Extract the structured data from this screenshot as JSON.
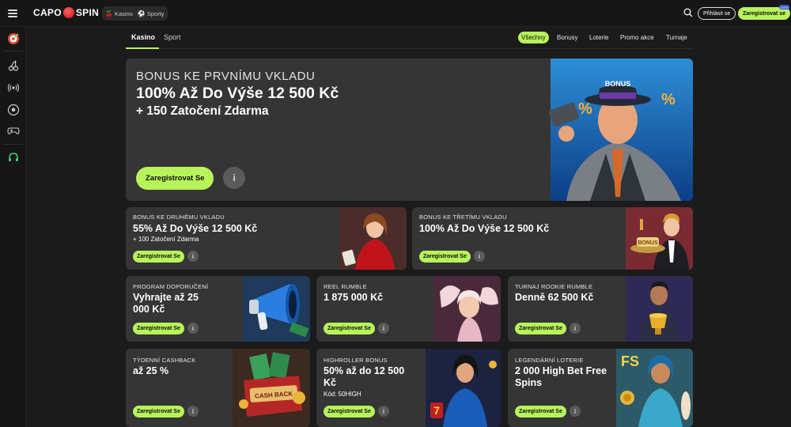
{
  "header": {
    "logo_left": "CAPO",
    "logo_right": "SPIN",
    "modes": [
      "Kasino",
      "Sporty"
    ],
    "login_label": "Přihlásit se",
    "register_label": "Zaregistrovat se",
    "register_badge": "100%"
  },
  "subnav": {
    "tabs": [
      "Kasino",
      "Sport"
    ],
    "filters": [
      "Všechny",
      "Bonusy",
      "Loterie",
      "Promo akce",
      "Turnaje"
    ]
  },
  "hero": {
    "label": "BONUS KE PRVNÍMU VKLADU",
    "title": "100% Až Do Výše 12 500 Kč",
    "subtitle": "+ 150 Zatočení Zdarma",
    "button": "Zaregistrovat Se",
    "art_label": "BONUS"
  },
  "cards": [
    {
      "label": "BONUS KE DRUHÉMU VKLADU",
      "title": "55% Až Do Výše 12 500 Kč",
      "sub": "+ 100 Zatočení Zdarma",
      "button": "Zaregistrovat Se"
    },
    {
      "label": "BONUS KE TŘETÍMU VKLADU",
      "title": "100% Až Do Výše 12 500 Kč",
      "sub": "",
      "button": "Zaregistrovat Se"
    },
    {
      "label": "PROGRAM DOPORUČENÍ",
      "title": "Vyhrajte až 25 000 Kč",
      "sub": "",
      "button": "Zaregistrovat Se"
    },
    {
      "label": "REEL RUMBLE",
      "title": "1 875 000 Kč",
      "sub": "",
      "button": "Zaregistrovat Se"
    },
    {
      "label": "TURNAJ ROOKIE RUMBLE",
      "title": "Denně 62 500 Kč",
      "sub": "",
      "button": "Zaregistrovat Se"
    },
    {
      "label": "TÝDENNÍ CASHBACK",
      "title": "až 25 %",
      "sub": "",
      "button": "Zaregistrovat Se"
    },
    {
      "label": "HIGHROLLER BONUS",
      "title": "50% až do 12 500 Kč",
      "sub": "Kód: 50HIGH",
      "button": "Zaregistrovat Se"
    },
    {
      "label": "LEGENDÁRNÍ LOTERIE",
      "title": "2 000 High Bet Free Spins",
      "sub": "",
      "button": "Zaregistrovat Se"
    }
  ],
  "art_texts": {
    "cashback": "CASH BACK",
    "bonus": "BONUS",
    "fs": "FS"
  },
  "colors": {
    "accent": "#b8f35a",
    "card_bg": "#353536",
    "page_bg": "#1b1b1c"
  }
}
